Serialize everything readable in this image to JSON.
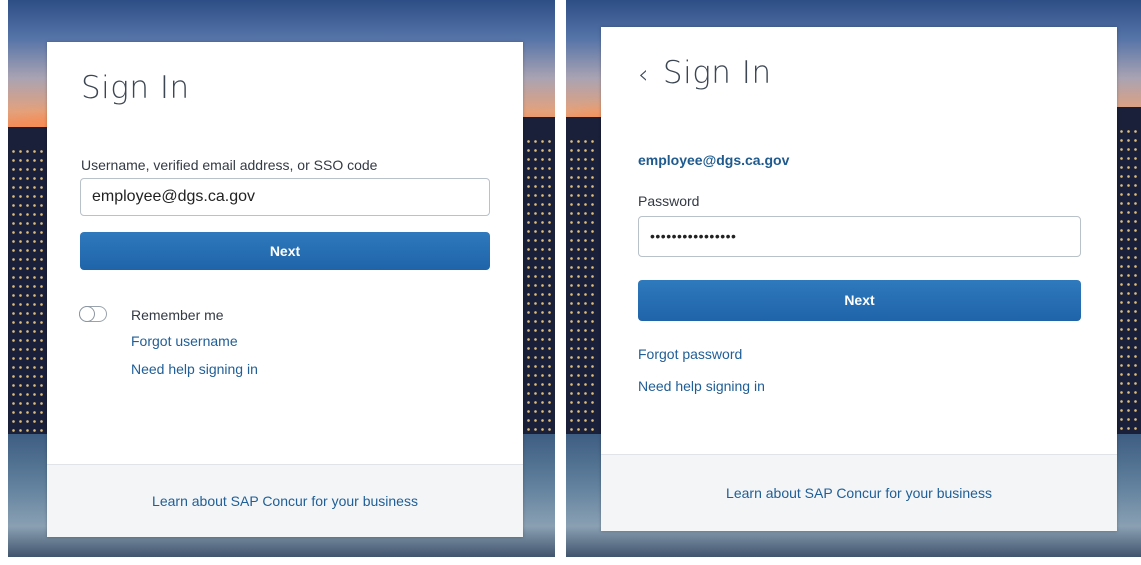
{
  "left": {
    "title": "Sign In",
    "username_label": "Username, verified email address, or SSO code",
    "username_value": "employee@dgs.ca.gov",
    "next_label": "Next",
    "remember_label": "Remember me",
    "remember_checked": false,
    "forgot_username": "Forgot username",
    "need_help": "Need help signing in",
    "footer_link": "Learn about SAP Concur for your business"
  },
  "right": {
    "back_icon": "‹",
    "title": "Sign In",
    "email": "employee@dgs.ca.gov",
    "password_label": "Password",
    "password_value": "••••••••••••••••",
    "next_label": "Next",
    "forgot_password": "Forgot password",
    "need_help": "Need help signing in",
    "footer_link": "Learn about SAP Concur for your business"
  },
  "colors": {
    "button": "#2170b3",
    "link": "#1f5e96",
    "footer_bg": "#f4f5f7"
  }
}
